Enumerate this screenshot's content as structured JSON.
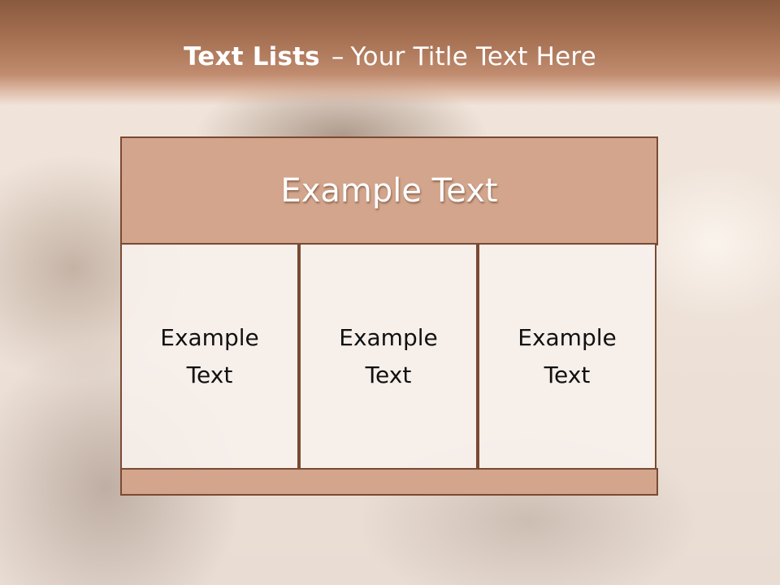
{
  "slide": {
    "title_bold": "Text Lists",
    "title_separator": "–",
    "title_rest": "Your Title Text Here"
  },
  "diagram": {
    "header": "Example Text",
    "columns": [
      {
        "text": "Example Text"
      },
      {
        "text": "Example Text"
      },
      {
        "text": "Example Text"
      }
    ]
  },
  "colors": {
    "header_band": "#a56f51",
    "box_fill": "#d2a58c",
    "box_border": "#7a4a33",
    "column_fill": "#f7f0eb"
  }
}
